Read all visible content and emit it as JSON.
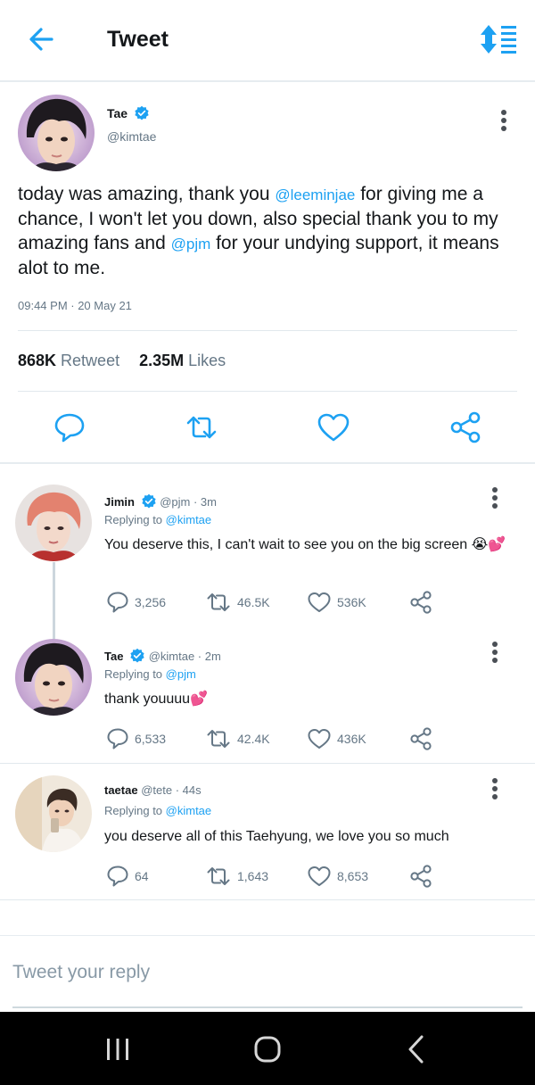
{
  "header": {
    "title": "Tweet"
  },
  "colors": {
    "accent": "#1da1f2",
    "text": "#14171a",
    "muted": "#657786"
  },
  "main_tweet": {
    "name": "Tae",
    "handle": "@kimtae",
    "text_1": "today was amazing, thank you ",
    "mention_1": "@leeminjae",
    "text_2": " for giving me a chance, I won't let you down, also special thank you to my amazing fans and ",
    "mention_2": "@pjm",
    "text_3": " for your undying support, it means alot to me.",
    "timestamp": "09:44 PM · 20 May 21",
    "retweets_count": "868K",
    "retweets_label": "Retweet",
    "likes_count": "2.35M",
    "likes_label": "Likes"
  },
  "replies": [
    {
      "name": "Jimin",
      "handle_time": "@pjm · 3m",
      "replying_label": "Replying to ",
      "replying_to": "@kimtae",
      "text": "You deserve this, I can't wait to see you on the big screen 😭💕",
      "comments": "3,256",
      "retweets": "46.5K",
      "likes": "536K"
    },
    {
      "name": "Tae",
      "handle_time": "@kimtae · 2m",
      "replying_label": "Replying to ",
      "replying_to": "@pjm",
      "text": "thank youuuu💕",
      "comments": "6,533",
      "retweets": "42.4K",
      "likes": "436K"
    },
    {
      "name": "taetae",
      "handle_time": "@tete · 44s",
      "replying_label": "Replying to ",
      "replying_to": "@kimtae",
      "text": "you deserve all of this Taehyung, we love you so much",
      "comments": "64",
      "retweets": "1,643",
      "likes": "8,653"
    }
  ],
  "reply_box": {
    "placeholder": "Tweet your reply"
  }
}
